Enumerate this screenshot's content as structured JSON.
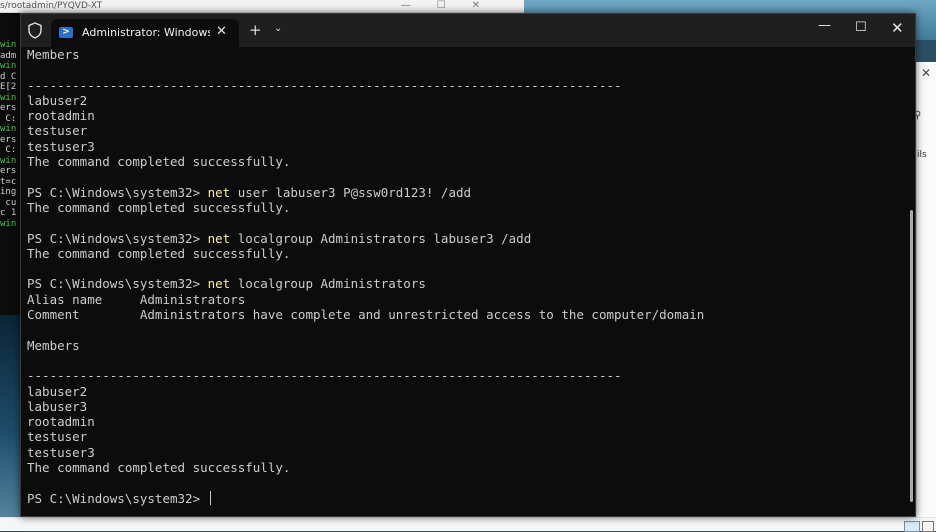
{
  "background": {
    "top_window_title": "s/rootadmin/PYQVD-XT",
    "left_window_lines": [
      "win",
      "adm",
      "",
      "win",
      "d C",
      "E[2",
      "win",
      "ers",
      " C:",
      "",
      "win",
      "ers",
      " C:",
      "",
      "win",
      "ers",
      "t=c",
      "ing",
      " cu",
      "c 1",
      "",
      "win"
    ],
    "right_panel_text": "ils"
  },
  "terminal": {
    "tab_title": "Administrator: Windows PowerShell",
    "tab_icon": "powershell-icon",
    "lines": [
      {
        "text": "Members"
      },
      {
        "text": ""
      },
      {
        "text": "-------------------------------------------------------------------------------"
      },
      {
        "text": "labuser2"
      },
      {
        "text": "rootadmin"
      },
      {
        "text": "testuser"
      },
      {
        "text": "testuser3"
      },
      {
        "text": "The command completed successfully."
      },
      {
        "text": ""
      },
      {
        "prompt": "PS C:\\Windows\\system32> ",
        "cmd": "net",
        "args": " user labuser3 P@ssw0rd123! /add"
      },
      {
        "text": "The command completed successfully."
      },
      {
        "text": ""
      },
      {
        "prompt": "PS C:\\Windows\\system32> ",
        "cmd": "net",
        "args": " localgroup Administrators labuser3 /add"
      },
      {
        "text": "The command completed successfully."
      },
      {
        "text": ""
      },
      {
        "prompt": "PS C:\\Windows\\system32> ",
        "cmd": "net",
        "args": " localgroup Administrators"
      },
      {
        "text": "Alias name     Administrators"
      },
      {
        "text": "Comment        Administrators have complete and unrestricted access to the computer/domain"
      },
      {
        "text": ""
      },
      {
        "text": "Members"
      },
      {
        "text": ""
      },
      {
        "text": "-------------------------------------------------------------------------------"
      },
      {
        "text": "labuser2"
      },
      {
        "text": "labuser3"
      },
      {
        "text": "rootadmin"
      },
      {
        "text": "testuser"
      },
      {
        "text": "testuser3"
      },
      {
        "text": "The command completed successfully."
      },
      {
        "text": ""
      },
      {
        "prompt": "PS C:\\Windows\\system32> ",
        "cursor": true
      }
    ]
  },
  "colors": {
    "console_bg": "#0c0c0c",
    "console_text": "#cccccc",
    "command_highlight": "#f9f1a5",
    "titlebar_bg": "#1f1f1f"
  }
}
